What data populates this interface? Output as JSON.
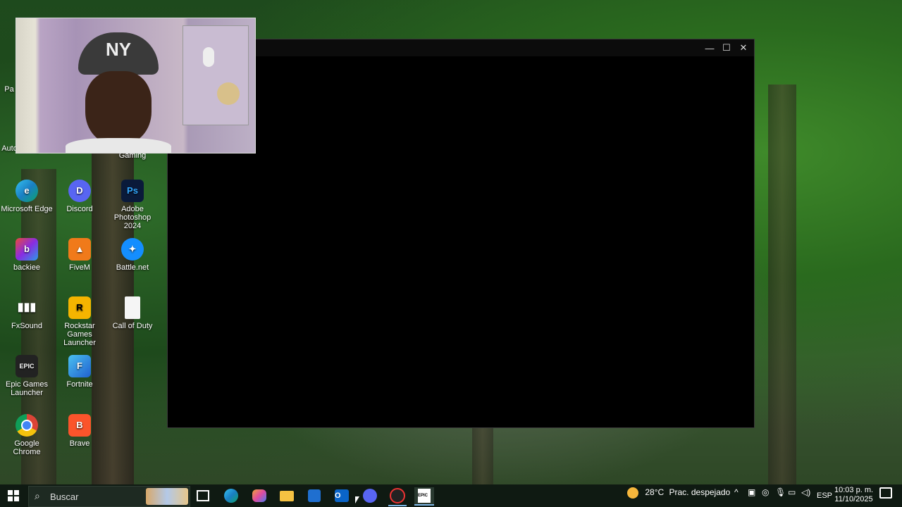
{
  "desktop_icons": [
    {
      "label": "Grand Theft Auto V Legacy",
      "short": "Auto V Legacy",
      "glyph": "GTA",
      "color": "#3a6f9a"
    },
    {
      "label": "Gaming",
      "short": "Gaming",
      "glyph": "G",
      "color": "#3e3e8a"
    },
    {
      "label": "Microsoft Edge",
      "short": "Microsoft Edge",
      "glyph": "e",
      "color": "#1e8fc8"
    },
    {
      "label": "Discord",
      "short": "Discord",
      "glyph": "D",
      "color": "#5865f2"
    },
    {
      "label": "Adobe Photoshop 2024",
      "short": "Adobe Photoshop 2024",
      "glyph": "Ps",
      "color": "#0a1a3a"
    },
    {
      "label": "backiee",
      "short": "backiee",
      "glyph": "b",
      "color": "#d63a3a"
    },
    {
      "label": "FiveM",
      "short": "FiveM",
      "glyph": "▲",
      "color": "#f07a1a"
    },
    {
      "label": "Battle.net",
      "short": "Battle.net",
      "glyph": "✦",
      "color": "#148eff"
    },
    {
      "label": "FxSound",
      "short": "FxSound",
      "glyph": "▮▮",
      "color": "#1d2b3a"
    },
    {
      "label": "Rockstar Games Launcher",
      "short": "Rockstar Games Launcher",
      "glyph": "R",
      "color": "#f4b400"
    },
    {
      "label": "Call of Duty",
      "short": "Call of Duty",
      "glyph": "",
      "color": "#f5f5f5"
    },
    {
      "label": "Epic Games Launcher",
      "short": "Epic Games Launcher",
      "glyph": "EPIC",
      "color": "#222"
    },
    {
      "label": "Fortnite",
      "short": "Fortnite",
      "glyph": "F",
      "color": "#2e8dd8"
    },
    {
      "label": "Google Chrome",
      "short": "Google Chrome",
      "glyph": "●",
      "color": "#e0e0e0"
    },
    {
      "label": "Brave",
      "short": "Brave",
      "glyph": "B",
      "color": "#fb542b"
    }
  ],
  "partial_icon_label": "Pa",
  "taskbar": {
    "search_placeholder": "Buscar",
    "weather_temp": "28°C",
    "weather_text": "Prac. despejado",
    "language": "ESP",
    "time": "10:03 p. m.",
    "date": "11/10/2025"
  },
  "window": {
    "minimize": "—",
    "maximize": "☐",
    "close": "✕"
  },
  "webcam_cap_text": "NY"
}
